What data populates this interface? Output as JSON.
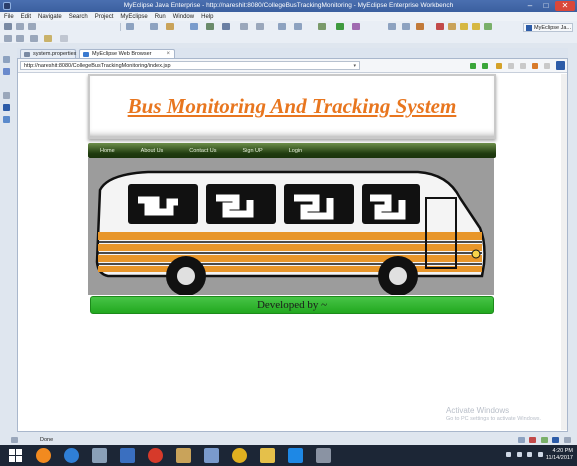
{
  "window": {
    "title": "MyEclipse Java Enterprise - http://nareshit:8080/CollegeBusTrackingMonitoring - MyEclipse Enterprise Workbench"
  },
  "menu": [
    "File",
    "Edit",
    "Navigate",
    "Search",
    "Project",
    "MyEclipse",
    "Run",
    "Window",
    "Help"
  ],
  "perspective": {
    "label": "MyEclipse Ja..."
  },
  "tabs": [
    {
      "label": "system.propertiex"
    },
    {
      "label": "MyEclipse Web Browser"
    }
  ],
  "browser": {
    "url": "http://nareshit:8080/CollegeBusTrackingMonitoring/index.jsp"
  },
  "page": {
    "title": "Bus Monitoring And Tracking System",
    "nav": [
      "Home",
      "About Us",
      "Contact Us",
      "Sign UP",
      "Login"
    ],
    "footer": "Developed by ~"
  },
  "watermark": {
    "line1": "Activate Windows",
    "line2": "Go to PC settings to activate Windows."
  },
  "status": {
    "text": "Done"
  },
  "clock": {
    "time": "4:20 PM",
    "date": "11/14/2017"
  }
}
